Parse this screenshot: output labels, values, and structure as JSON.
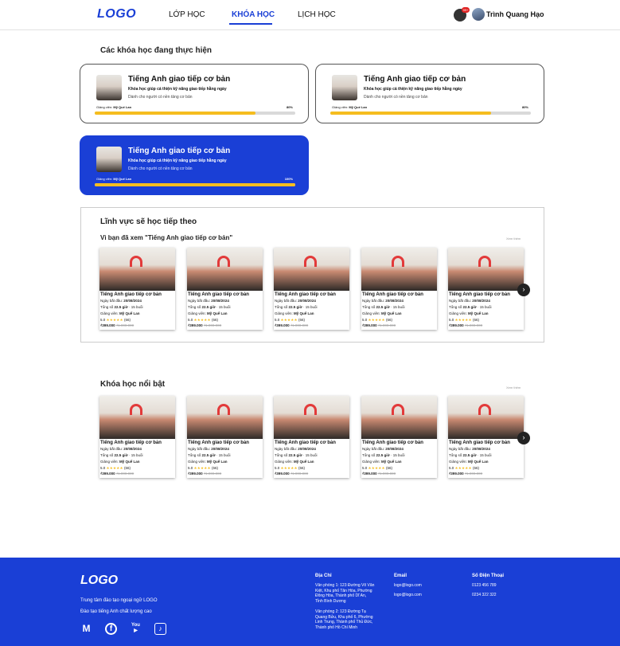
{
  "header": {
    "logo": "LOGO",
    "nav": [
      "LỚP HỌC",
      "KHÓA HỌC",
      "LỊCH HỌC"
    ],
    "active_nav": "KHÓA HỌC",
    "notification_badge": "99+",
    "user_name": "Trình Quang Hạo"
  },
  "in_progress": {
    "title": "Các khóa học đang thực hiện",
    "cards": [
      {
        "title": "Tiếng Anh giao tiếp cơ bản",
        "subtitle": "Khóa học giúp cả thiện kỹ năng giao tiếp hằng ngày",
        "desc": "Dành cho người có nền tảng cơ bản",
        "teacher_label": "Giảng viên:",
        "teacher": "Mỹ Quế Lan",
        "progress_text": "80%",
        "progress": 0.8
      },
      {
        "title": "Tiếng Anh giao tiếp cơ bản",
        "subtitle": "Khóa học giúp cả thiện kỹ năng giao tiếp hằng ngày",
        "desc": "Dành cho người có nền tảng cơ bản",
        "teacher_label": "Giảng viên:",
        "teacher": "Mỹ Quế Lan",
        "progress_text": "80%",
        "progress": 0.8
      },
      {
        "title": "Tiếng Anh giao tiếp cơ bản",
        "subtitle": "Khóa học giúp cả thiện kỹ năng giao tiếp hằng ngày",
        "desc": "Dành cho người có nền tảng cơ bản",
        "teacher_label": "Giảng viên:",
        "teacher": "Mỹ Quế Lan",
        "progress_text": "100%",
        "progress": 1.0
      }
    ]
  },
  "next_field": {
    "title": "Lĩnh vực sẽ học tiếp theo",
    "subtitle": "Vì bạn đã xem \"Tiếng Anh giao tiếp cơ bản\"",
    "see_all": "Xem thêm"
  },
  "featured": {
    "title": "Khóa học nổi bật",
    "see_all": "Xem thêm"
  },
  "course": {
    "title": "Tiếng Anh giao tiếp cơ bản",
    "start_label": "Ngày bắt đầu:",
    "start": "20/08/2024",
    "total_label": "Tổng số",
    "hours": "22.5 giờ",
    "sessions": "· 15 buổi",
    "teacher_label": "Giảng viên:",
    "teacher": "Mỹ Quế Lan",
    "rating": "5.0",
    "stars": "★★★★★",
    "reviews": "(66)",
    "price": "₫399.000",
    "old_price": "₫1.000.000"
  },
  "footer": {
    "logo": "LOGO",
    "line1": "Trung tâm đào tạo ngoại ngữ LOGO",
    "line2": "Đào tạo tiếng Anh chất lượng cao",
    "address_head": "Địa Chỉ",
    "address1": [
      "Văn phòng 1: 123 Đường Võ Văn",
      "Kiệt, Khu phố Tân Hòa, Phường",
      "Đông Hòa, Thành phố Dĩ An,",
      "Tỉnh  Bình Dương"
    ],
    "address2": [
      "Văn phòng 2: 123 Đường Tạ",
      "Quang Bửu, Khu phố 6, Phường",
      "Linh Trung, Thành phố Thủ Đức,",
      "Thành phố Hồ Chí Minh"
    ],
    "email_head": "Email",
    "emails": [
      "logo@logo.com",
      "logo@logo.com"
    ],
    "phone_head": "Số Điện Thoại",
    "phones": [
      "0123 456 789",
      "0234 322 322"
    ]
  },
  "colors": {
    "brand": "#1a3fd6",
    "progress": "#f5bd1f"
  },
  "icons": [
    "bell-icon",
    "gmail-icon",
    "facebook-icon",
    "youtube-icon",
    "tiktok-icon",
    "chevron-right-icon"
  ]
}
